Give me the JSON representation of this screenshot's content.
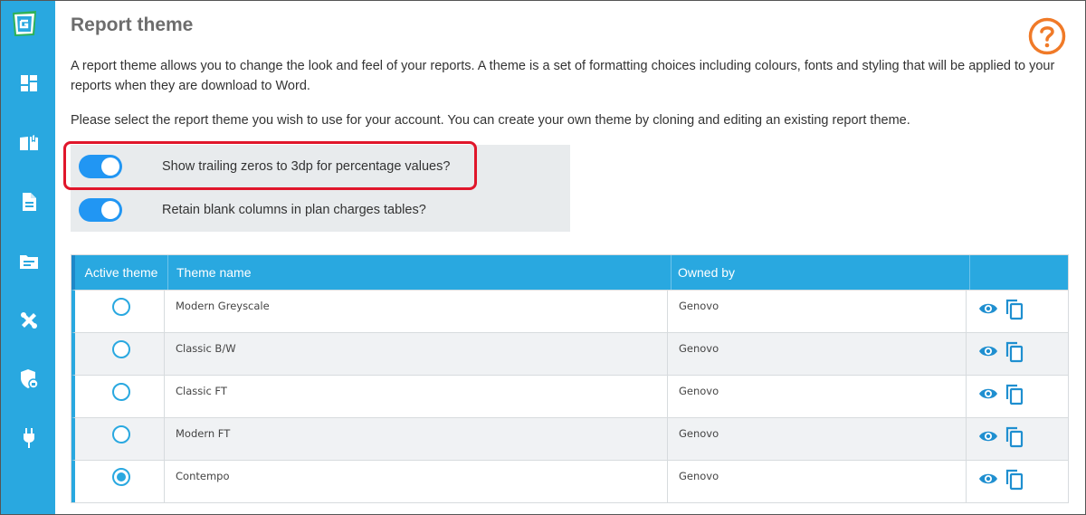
{
  "colors": {
    "sidebar": "#29a8e0",
    "accent": "#29a8e0",
    "toggle_on": "#2196f3",
    "highlight": "#e0162b",
    "help": "#f07a28",
    "title": "#6d6d6d"
  },
  "sidebar": {
    "logo": "genovo-logo",
    "items": [
      {
        "icon": "dashboard-icon"
      },
      {
        "icon": "book-open-icon"
      },
      {
        "icon": "document-icon"
      },
      {
        "icon": "folder-icon"
      },
      {
        "icon": "tools-icon"
      },
      {
        "icon": "shield-lock-icon"
      },
      {
        "icon": "plug-icon"
      }
    ]
  },
  "page": {
    "title": "Report theme",
    "help_icon": "help-icon",
    "description": "A report theme allows you to change the look and feel of your reports. A theme is a set of formatting choices including colours, fonts and styling that will be applied to your reports when they are download to Word.",
    "instruction": "Please select the report theme you wish to use for your account. You can create your own theme by cloning and editing an existing report theme."
  },
  "options": [
    {
      "label": "Show trailing zeros to 3dp for percentage values?",
      "enabled": true
    },
    {
      "label": "Retain blank columns in plan charges tables?",
      "enabled": true
    }
  ],
  "table": {
    "headers": [
      "Active theme",
      "Theme name",
      "Owned by",
      ""
    ],
    "rows": [
      {
        "active": false,
        "name": "Modern Greyscale",
        "owner": "Genovo"
      },
      {
        "active": false,
        "name": "Classic B/W",
        "owner": "Genovo"
      },
      {
        "active": false,
        "name": "Classic FT",
        "owner": "Genovo"
      },
      {
        "active": false,
        "name": "Modern FT",
        "owner": "Genovo"
      },
      {
        "active": true,
        "name": "Contempo",
        "owner": "Genovo"
      }
    ],
    "row_actions": [
      "eye-icon",
      "copy-icon"
    ]
  }
}
